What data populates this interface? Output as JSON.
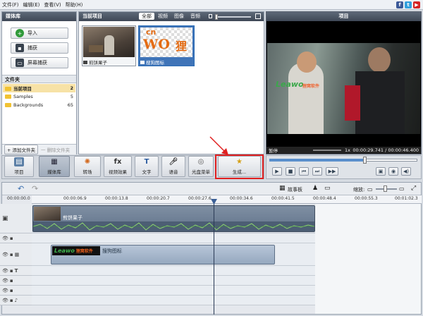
{
  "menu": {
    "items": [
      "文件(F)",
      "编辑(E)",
      "查看(V)",
      "帮助(H)"
    ]
  },
  "social": [
    "f",
    "t",
    "▶"
  ],
  "library": {
    "title": "媒体库",
    "buttons": [
      "导入",
      "捕获",
      "屏幕捕获"
    ]
  },
  "folders": {
    "title": "文件夹",
    "items": [
      {
        "name": "当前项目",
        "count": "2"
      },
      {
        "name": "Samples",
        "count": "5"
      },
      {
        "name": "Backgrounds",
        "count": "65"
      }
    ],
    "add_label": "+ 添加文件夹",
    "delete_label": "一 删除文件夹"
  },
  "project": {
    "title": "当前项目",
    "filters": [
      "全部",
      "视频",
      "图像",
      "音频"
    ],
    "thumbs": [
      {
        "label": "煎饼果子"
      },
      {
        "label": "搜狗图标",
        "logo_top": "cn",
        "logo_main": "WO",
        "logo_side": "狸"
      }
    ]
  },
  "preview": {
    "title": "项目",
    "watermark": "Leawo",
    "watermark_cn": "狸窝软件",
    "status": "暂停",
    "speed": "1x",
    "time": "00:00:29.741 / 00:00:46.400"
  },
  "toolbar": {
    "items": [
      "项目",
      "媒体库",
      "转场",
      "视频效果",
      "文字",
      "语音",
      "光盘菜单",
      "生成..."
    ]
  },
  "timeline": {
    "storyboard": "故事板",
    "zoom": "缩放:",
    "ticks": [
      "00:00:00.0",
      "00:00:06.9",
      "00:00:13.8",
      "00:00:20.7",
      "00:00:27.6",
      "00:00:34.6",
      "00:00:41.5",
      "00:00:48.4",
      "00:00:55.3",
      "00:01:02.3"
    ],
    "video_clip": "煎饼果子",
    "overlay_clip": "搜狗图标",
    "overlay_logo": "Leawo",
    "overlay_logo_cn": "狸窝软件"
  },
  "colors": {
    "accent": "#2b6cb5",
    "highlight": "#e02020",
    "header": "#4a5464"
  }
}
